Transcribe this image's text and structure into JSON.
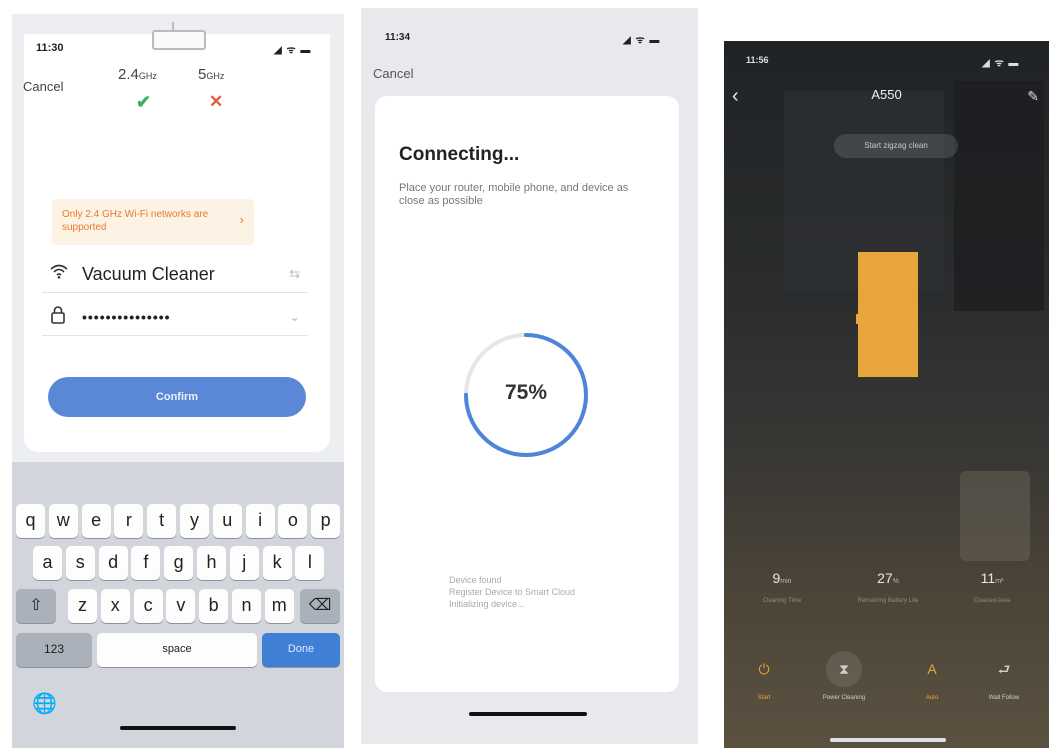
{
  "panel1": {
    "status": {
      "time": "11:30",
      "icons": "◢ ᯤ ▬"
    },
    "cancel": "Cancel",
    "bands": [
      {
        "label": "2.4",
        "unit": "GHz",
        "ok": "✔"
      },
      {
        "label": "5",
        "unit": "GHz",
        "ok": "✕"
      }
    ],
    "notice": "Only 2.4 GHz Wi-Fi networks are supported",
    "notice_chevron": "›",
    "network_name": "Vacuum Cleaner",
    "password_mask": "•••••••••••••••",
    "confirm": "Confirm",
    "keyboard": {
      "row1": [
        "q",
        "w",
        "e",
        "r",
        "t",
        "y",
        "u",
        "i",
        "o",
        "p"
      ],
      "row2": [
        "a",
        "s",
        "d",
        "f",
        "g",
        "h",
        "j",
        "k",
        "l"
      ],
      "row3": [
        "z",
        "x",
        "c",
        "v",
        "b",
        "n",
        "m"
      ],
      "shift": "⇧",
      "delete": "⌫",
      "numbers": "123",
      "space": "space",
      "done": "Done",
      "globe": "🌐"
    }
  },
  "panel2": {
    "status": {
      "time": "11:34",
      "icons": "◢ ᯤ ▬"
    },
    "cancel": "Cancel",
    "title": "Connecting...",
    "description": "Place your router, mobile phone, and device as close as possible",
    "progress": 75,
    "progress_text": "75%",
    "log": [
      "Device found",
      "Register Device to Smart Cloud",
      "Initializing device..."
    ]
  },
  "panel3": {
    "status": {
      "time": "11:56",
      "icons": "◢ ᯤ ▬"
    },
    "device_name": "A550",
    "mode": "Start zigzag clean",
    "stats": [
      {
        "value": "9",
        "unit": "min",
        "label": "Cleaning Time"
      },
      {
        "value": "27",
        "unit": "%",
        "label": "Remaining Battery Life"
      },
      {
        "value": "11",
        "unit": "m²",
        "label": "Cleaned Area"
      }
    ],
    "controls": [
      {
        "icon": "⏻",
        "label": "Start",
        "color": "#e8a53b"
      },
      {
        "icon": "⧗",
        "label": "Power Cleaning",
        "color": "#cfcfcf"
      },
      {
        "icon": "A",
        "label": "Auto",
        "color": "#e8a53b"
      },
      {
        "icon": "⮐",
        "label": "Wall Follow",
        "color": "#cfcfcf"
      }
    ]
  },
  "colors": {
    "accent_blue": "#5b88d6",
    "success": "#3bb06a",
    "error": "#e25a3c",
    "map_orange": "#e8a53b"
  }
}
